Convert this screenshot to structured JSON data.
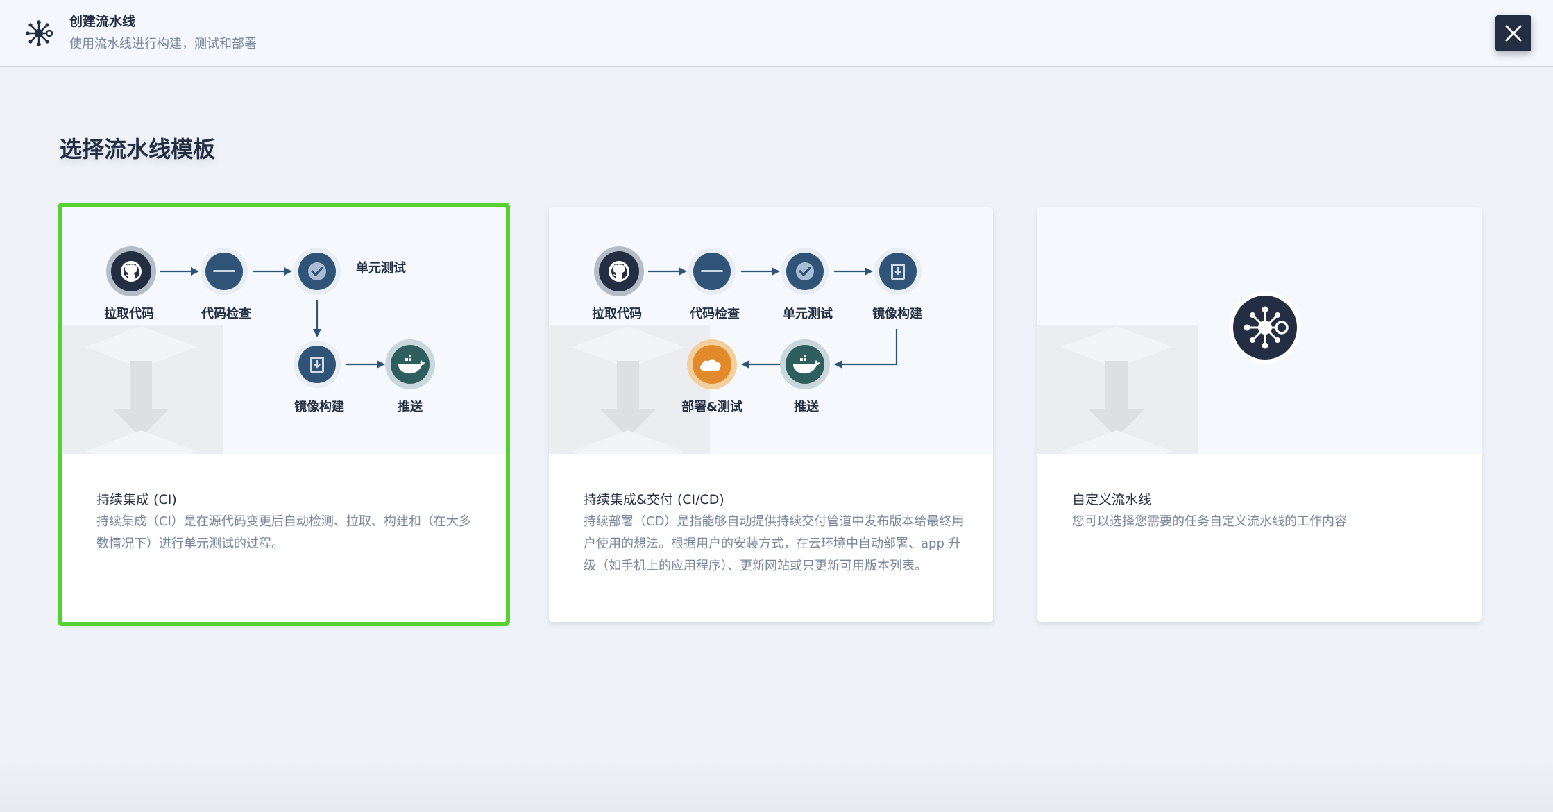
{
  "header": {
    "title": "创建流水线",
    "subtitle": "使用流水线进行构建，测试和部署",
    "close_label": "×"
  },
  "section_title": "选择流水线模板",
  "cards": [
    {
      "id": "ci",
      "selected": true,
      "title": "持续集成 (CI)",
      "description": "持续集成（CI）是在源代码变更后自动检测、拉取、构建和（在大多数情况下）进行单元测试的过程。",
      "steps": {
        "pull": "拉取代码",
        "check": "代码检查",
        "test": "单元测试",
        "build": "镜像构建",
        "push": "推送"
      }
    },
    {
      "id": "cicd",
      "selected": false,
      "title": "持续集成&交付 (CI/CD)",
      "description": "持续部署（CD）是指能够自动提供持续交付管道中发布版本给最终用户使用的想法。根据用户的安装方式，在云环境中自动部署、app 升级（如手机上的应用程序）、更新网站或只更新可用版本列表。",
      "steps": {
        "pull": "拉取代码",
        "check": "代码检查",
        "test": "单元测试",
        "build": "镜像构建",
        "deploy": "部署&测试",
        "push": "推送"
      }
    },
    {
      "id": "custom",
      "selected": false,
      "title": "自定义流水线",
      "description": "您可以选择您需要的任务自定义流水线的工作内容"
    }
  ],
  "icons": {
    "pull": "github-icon",
    "check": "sonarqube-icon",
    "test": "check-icon",
    "build": "image-build-icon",
    "push": "docker-icon",
    "deploy": "cloud-icon",
    "custom": "pipeline-hub-icon"
  },
  "colors": {
    "selected_border": "#55d134",
    "dark": "#242e42",
    "node_blue": "#2f5478",
    "muted_text": "#79879c"
  }
}
